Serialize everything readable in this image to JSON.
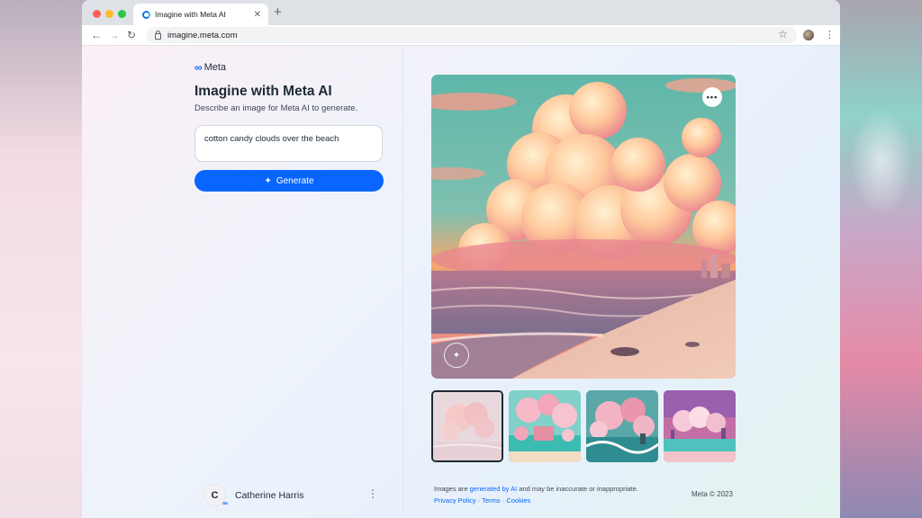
{
  "browser": {
    "tab_title": "Imagine with Meta AI",
    "tab_close": "✕",
    "new_tab": "+",
    "url": "imagine.meta.com",
    "back": "←",
    "forward": "→",
    "reload": "↻",
    "star": "☆",
    "menu": "⋮"
  },
  "sidebar": {
    "logo_mark": "∞",
    "logo_text": "Meta",
    "title": "Imagine with Meta AI",
    "subtitle": "Describe an image for Meta AI to generate.",
    "prompt_value": "cotton candy clouds over the beach",
    "generate_icon": "✦",
    "generate_label": "Generate",
    "user": {
      "initial": "C",
      "badge": "∞",
      "name": "Catherine Harris",
      "menu": "⋮"
    }
  },
  "main": {
    "more_label": "•••",
    "watermark": "✦",
    "thumbnail_count": 4,
    "selected_thumbnail": 1,
    "disclaimer_prefix": "Images are ",
    "disclaimer_link": "generated by AI",
    "disclaimer_suffix": " and may be inaccurate or inappropriate.",
    "links": {
      "privacy": "Privacy Policy",
      "sep1": " · ",
      "terms": "Terms",
      "sep2": " · ",
      "cookies": "Cookies"
    },
    "copyright": "Meta © 2023"
  },
  "colors": {
    "accent": "#0866ff",
    "text": "#1c2b33"
  },
  "icons": [
    "meta-logo-icon",
    "sparkle-icon",
    "lock-icon",
    "star-icon",
    "more-icon",
    "kebab-icon"
  ]
}
